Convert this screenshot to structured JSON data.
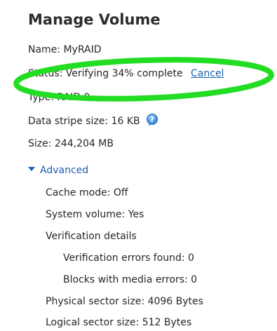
{
  "panel": {
    "title": "Manage Volume",
    "name": "Name: MyRAID",
    "status": "Status: Verifying 34% complete",
    "cancel_label": "Cancel",
    "type": "Type: RAID 0",
    "stripe_size": "Data stripe size: 16 KB",
    "size": "Size: 244,204 MB"
  },
  "advanced": {
    "label": "Advanced",
    "cache_mode": "Cache mode: Off",
    "system_volume": "System volume: Yes",
    "verification_details": "Verification details",
    "errors_found": "Verification errors found: 0",
    "media_errors": "Blocks with media errors: 0",
    "physical_sector": "Physical sector size: 4096 Bytes",
    "logical_sector": "Logical sector size: 512 Bytes"
  },
  "colors": {
    "link": "#1a5fb4",
    "highlight": "#22dd22",
    "help_icon": "#3a8ee6"
  },
  "icons": {
    "help": "question-mark-circle",
    "expander": "triangle-down"
  }
}
